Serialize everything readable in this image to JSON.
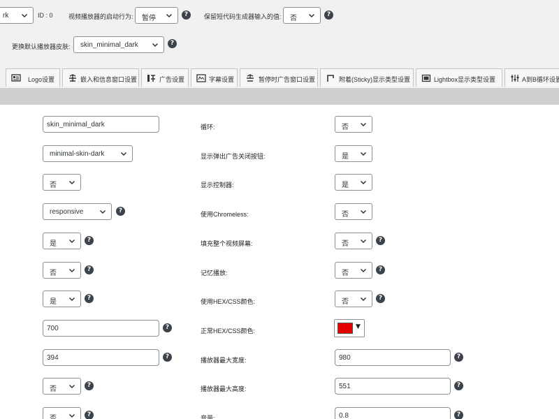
{
  "top": {
    "skin_select_value": "rk",
    "id_text": "ID : 0",
    "start_behavior_label": "视频播放器的启动行为:",
    "start_behavior_value": "暂停",
    "keep_shortcode_label": "保留短代码生成器输入的值:",
    "keep_shortcode_value": "否",
    "change_skin_label": "更换默认播放器皮肤:",
    "change_skin_value": "skin_minimal_dark"
  },
  "tabs": [
    {
      "label": "Logo设置",
      "icon": "logo-icon"
    },
    {
      "label": "嵌入和信息窗口设置",
      "icon": "embed-icon"
    },
    {
      "label": "广告设置",
      "icon": "ads-icon"
    },
    {
      "label": "字幕设置",
      "icon": "subtitle-icon"
    },
    {
      "label": "暂停时广告窗口设置",
      "icon": "pause-ad-icon"
    },
    {
      "label": "附着(Sticky)显示类型设置",
      "icon": "sticky-icon"
    },
    {
      "label": "Lightbox显示类型设置",
      "icon": "lightbox-icon"
    },
    {
      "label": "A到B循环设置",
      "icon": "ab-loop-icon"
    }
  ],
  "left": {
    "skin_input": "skin_minimal_dark",
    "skin_css_select": "minimal-skin-dark",
    "select_no_1": "否",
    "responsive_select": "responsive",
    "select_yes_1": "是",
    "select_no_2": "否",
    "select_yes_2": "是",
    "width_input": "700",
    "height_input": "394",
    "select_no_3": "否",
    "select_no_4": "否"
  },
  "mid_labels": {
    "loop": "循环:",
    "show_ad_close": "显示弹出广告关闭按钮:",
    "show_controls": "显示控制器:",
    "chromeless": "使用Chromeless:",
    "fill_screen": "填充整个视频屏幕:",
    "remember_play": "记忆播放:",
    "use_hex": "使用HEX/CSS颜色:",
    "normal_hex": "正常HEX/CSS颜色:",
    "max_width": "播放器最大宽度:",
    "max_height": "播放器最大高度:",
    "volume": "音量:"
  },
  "right": {
    "loop": "否",
    "show_ad_close": "是",
    "show_controls": "是",
    "chromeless": "否",
    "fill_screen": "否",
    "remember_play": "否",
    "use_hex": "否",
    "max_width": "980",
    "max_height": "551",
    "volume": "0.8"
  },
  "colors": {
    "normal_hex_swatch": "#e50000",
    "help_icon": "#3c434a",
    "band": "#cfcfcf"
  }
}
